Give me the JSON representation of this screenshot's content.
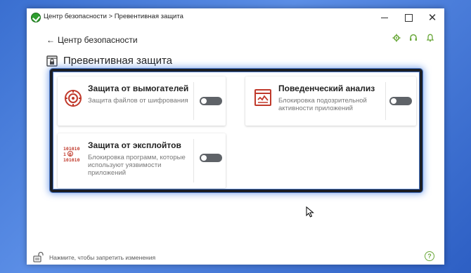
{
  "window": {
    "title": "Центр безопасности > Превентивная защита"
  },
  "nav": {
    "back_label": "Центр безопасности"
  },
  "page": {
    "title": "Превентивная защита"
  },
  "cards": [
    {
      "title": "Защита от вымогателей",
      "desc_lines": [
        "Защита файлов от шифрования"
      ],
      "toggle_on": false
    },
    {
      "title": "Поведенческий анализ",
      "desc_lines": [
        "Блокировка подозрительной",
        "активности приложений"
      ],
      "toggle_on": false
    },
    {
      "title": "Защита от эксплойтов",
      "desc_lines": [
        "Блокировка программ, которые",
        "используют уязвимости",
        "приложений"
      ],
      "toggle_on": false
    }
  ],
  "footer": {
    "lock_text": "Нажмите, чтобы запретить изменения"
  },
  "colors": {
    "accent_green": "#6aa83a",
    "icon_red": "#c0392b",
    "toggle_off": "#5f6368"
  },
  "icons": {
    "exploit_code": [
      "101010",
      "1 0",
      "101010"
    ]
  }
}
